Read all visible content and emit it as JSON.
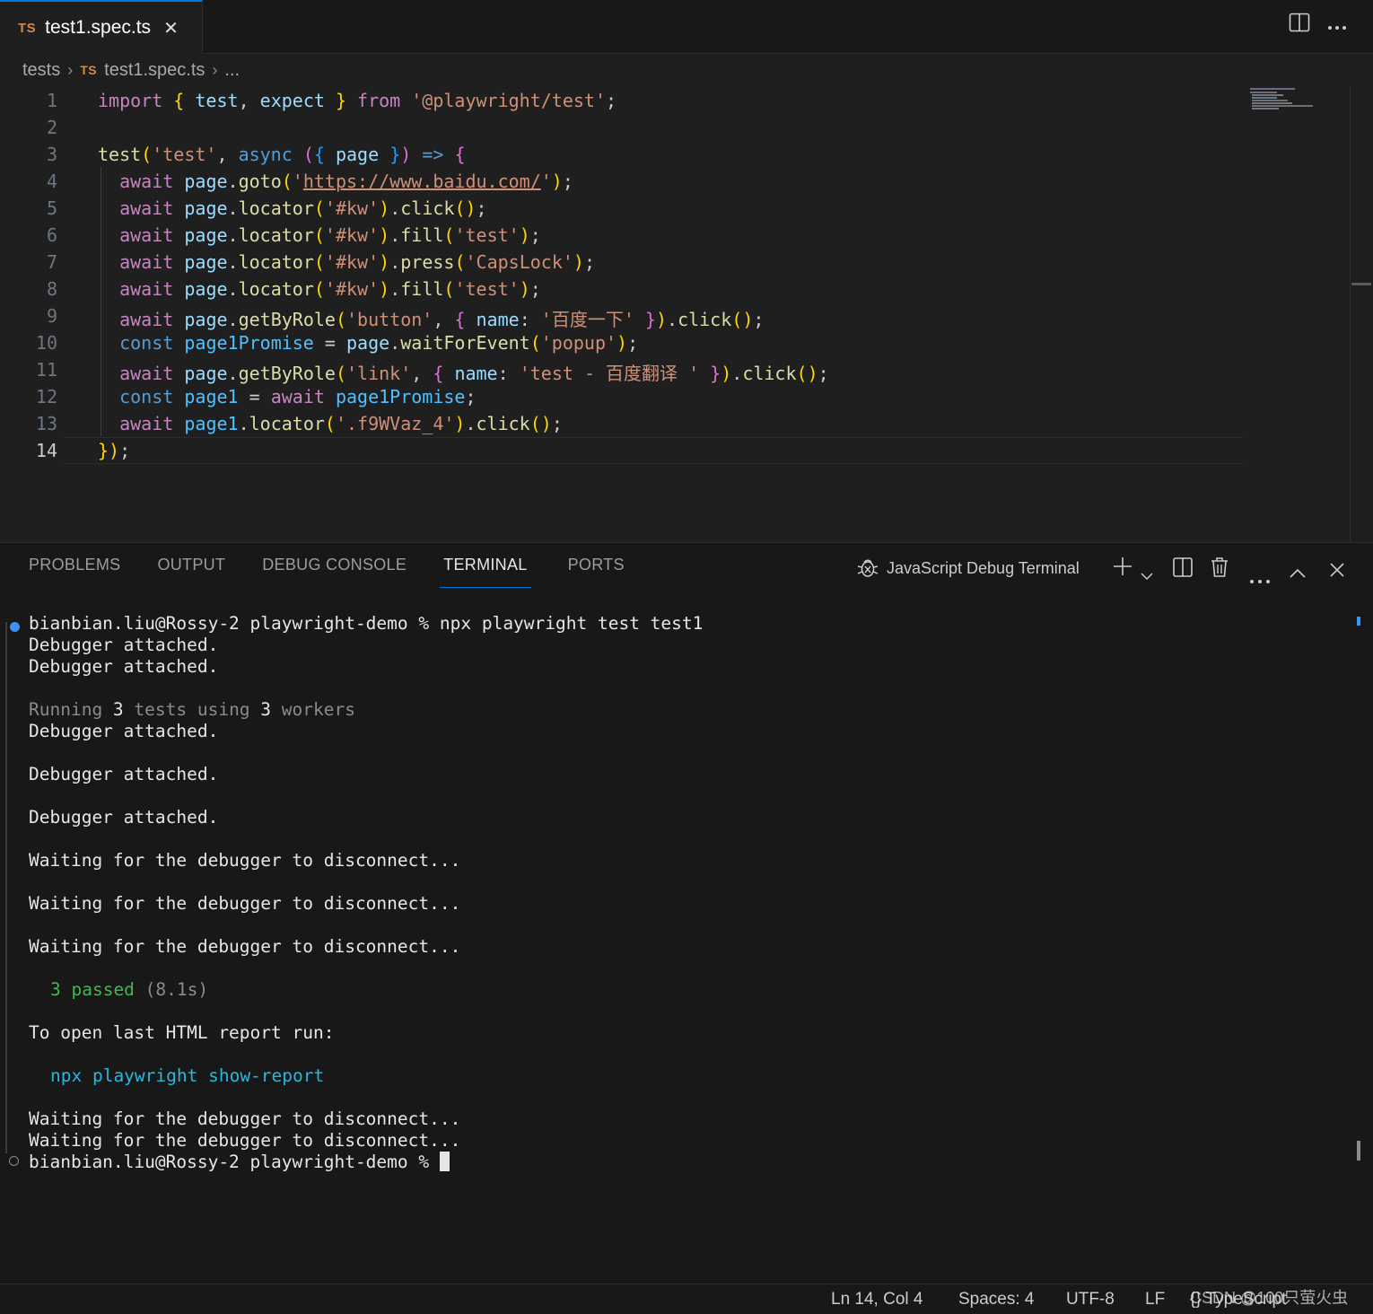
{
  "tab": {
    "badge": "TS",
    "title": "test1.spec.ts",
    "close_glyph": "✕"
  },
  "breadcrumb": {
    "folder": "tests",
    "badge": "TS",
    "file": "test1.spec.ts",
    "more": "..."
  },
  "editor": {
    "line_numbers": [
      "1",
      "2",
      "3",
      "4",
      "5",
      "6",
      "7",
      "8",
      "9",
      "10",
      "11",
      "12",
      "13",
      "14"
    ],
    "current_line": "14",
    "lines": [
      "import { test, expect } from '@playwright/test';",
      "",
      "test('test', async ({ page }) => {",
      "  await page.goto('https://www.baidu.com/');",
      "  await page.locator('#kw').click();",
      "  await page.locator('#kw').fill('test');",
      "  await page.locator('#kw').press('CapsLock');",
      "  await page.locator('#kw').fill('test');",
      "  await page.getByRole('button', { name: '百度一下' }).click();",
      "  const page1Promise = page.waitForEvent('popup');",
      "  await page.getByRole('link', { name: 'test - 百度翻译 ' }).click();",
      "  const page1 = await page1Promise;",
      "  await page1.locator('.f9WVaz_4').click();",
      "});"
    ]
  },
  "panel": {
    "tabs": [
      "PROBLEMS",
      "OUTPUT",
      "DEBUG CONSOLE",
      "TERMINAL",
      "PORTS"
    ],
    "active_tab": "TERMINAL",
    "terminal_name": "JavaScript Debug Terminal"
  },
  "terminal": {
    "prompt": "bianbian.liu@Rossy-2 playwright-demo % ",
    "command": "npx playwright test test1",
    "debugger_attached": "Debugger attached.",
    "running": {
      "w1": "Running ",
      "n1": "3",
      "w2": " tests using ",
      "n2": "3",
      "w3": " workers"
    },
    "waiting": "Waiting for the debugger to disconnect...",
    "passed": "3 passed",
    "duration": "(8.1s)",
    "report_hint": "To open last HTML report run:",
    "report_cmd": "npx playwright show-report"
  },
  "statusbar": {
    "position": "Ln 14, Col 4",
    "spaces": "Spaces: 4",
    "encoding": "UTF-8",
    "eol": "LF",
    "language": "{} TypeScript"
  },
  "watermark": "CSDN @100只萤火虫",
  "icons": [
    "close-icon",
    "split-editor-icon",
    "more-icon",
    "chevron-right-icon",
    "debug-icon",
    "plus-icon",
    "chevron-down-icon",
    "trash-icon",
    "chevron-up-icon"
  ],
  "colors": {
    "accent": "#0078d4",
    "keyword": "#c586c0",
    "string": "#ce9178",
    "function": "#dcdcaa",
    "variable": "#9cdcfe",
    "passed": "#3fb950",
    "report_cmd": "#29b8db"
  }
}
